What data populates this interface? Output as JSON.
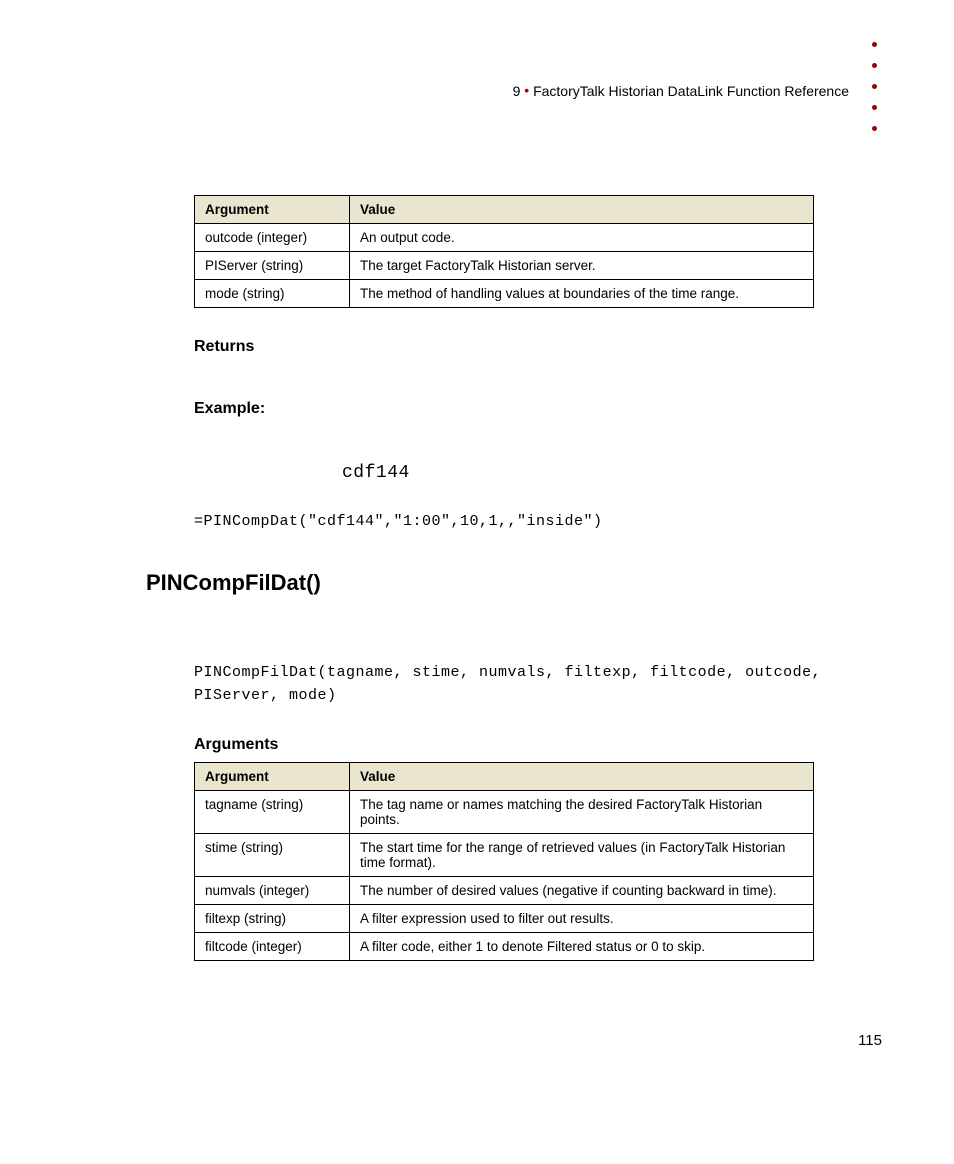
{
  "header": {
    "chapter_num": "9",
    "chapter_title": "FactoryTalk Historian DataLink Function Reference"
  },
  "table1": {
    "col1": "Argument",
    "col2": "Value",
    "rows": [
      {
        "arg": "outcode (integer)",
        "val": "An output code."
      },
      {
        "arg": "PIServer (string)",
        "val": "The target FactoryTalk Historian server."
      },
      {
        "arg": "mode (string)",
        "val": "The method of handling values at boundaries of the time range."
      }
    ]
  },
  "returns_h": "Returns",
  "example_h": "Example:",
  "example_val": "cdf144",
  "example_code": "=PINCompDat(\"cdf144\",\"1:00\",10,1,,\"inside\")",
  "func_title": "PINCompFilDat()",
  "syntax": "PINCompFilDat(tagname, stime, numvals, filtexp, filtcode, outcode, PIServer, mode)",
  "arguments_h": "Arguments",
  "table2": {
    "col1": "Argument",
    "col2": "Value",
    "rows": [
      {
        "arg": "tagname (string)",
        "val": "The tag name or names matching the desired FactoryTalk Historian points."
      },
      {
        "arg": "stime (string)",
        "val": "The start time for the range of retrieved values (in FactoryTalk Historian time format)."
      },
      {
        "arg": "numvals (integer)",
        "val": "The number of desired values (negative if counting backward in time)."
      },
      {
        "arg": "filtexp (string)",
        "val": "A filter expression used to filter out results."
      },
      {
        "arg": "filtcode (integer)",
        "val": "A filter code, either 1 to denote Filtered status or 0 to skip."
      }
    ]
  },
  "page_num": "115"
}
